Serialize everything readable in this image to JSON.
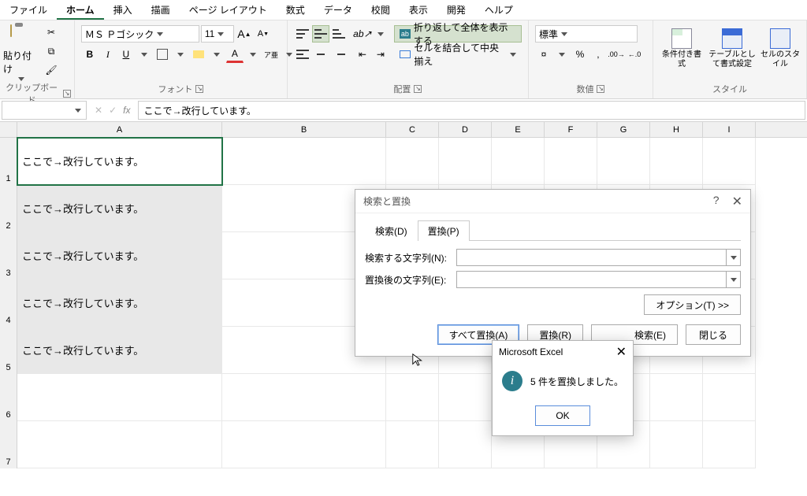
{
  "menu": {
    "items": [
      "ファイル",
      "ホーム",
      "挿入",
      "描画",
      "ページ レイアウト",
      "数式",
      "データ",
      "校閲",
      "表示",
      "開発",
      "ヘルプ"
    ],
    "active_index": 1
  },
  "ribbon": {
    "clipboard": {
      "label": "クリップボード",
      "paste": "貼り付け"
    },
    "font": {
      "label": "フォント",
      "name": "ＭＳ Ｐゴシック",
      "size": "11",
      "bold": "B",
      "italic": "I",
      "underline": "U"
    },
    "alignment": {
      "label": "配置",
      "wrap": "折り返して全体を表示する",
      "merge": "セルを結合して中央揃え"
    },
    "number": {
      "label": "数値",
      "format": "標準"
    },
    "styles": {
      "label": "スタイル",
      "cond": "条件付き書式",
      "table": "テーブルとして書式設定",
      "cell": "セルのスタイル"
    }
  },
  "namebox": "",
  "formula_prefix_fx": "fx",
  "formula_bar": "ここで→改行しています。",
  "columns": [
    "A",
    "B",
    "C",
    "D",
    "E",
    "F",
    "G",
    "H",
    "I"
  ],
  "rows": [
    "1",
    "2",
    "3",
    "4",
    "5",
    "6",
    "7"
  ],
  "cells": {
    "A1": "ここで→改行しています。",
    "A2": "ここで→改行しています。",
    "A3": "ここで→改行しています。",
    "A4": "ここで→改行しています。",
    "A5": "ここで→改行しています。"
  },
  "find_replace": {
    "title": "検索と置換",
    "help": "?",
    "tab_find": "検索(D)",
    "tab_replace": "置換(P)",
    "label_find": "検索する文字列(N):",
    "label_replace": "置換後の文字列(E):",
    "find_value": "",
    "replace_value": "",
    "options": "オプション(T) >>",
    "btn_replace_all": "すべて置換(A)",
    "btn_replace": "置換(R)",
    "btn_find_all_suffix": "検索(E)",
    "btn_close": "閉じる"
  },
  "msg": {
    "title": "Microsoft Excel",
    "text": "5 件を置換しました。",
    "ok": "OK"
  },
  "ab_label": "ab"
}
